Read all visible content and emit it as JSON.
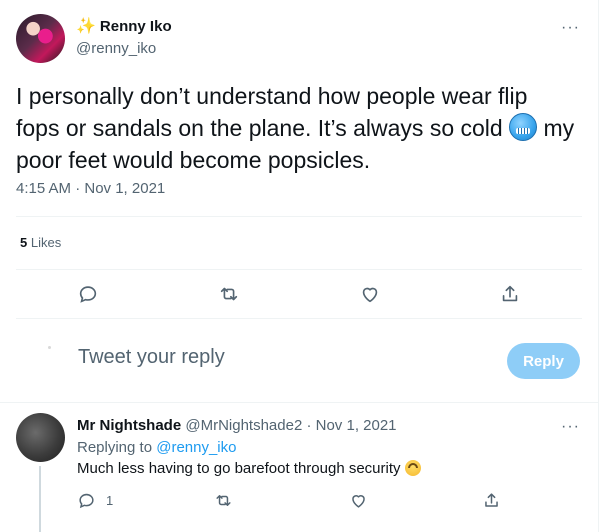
{
  "tweet": {
    "display_name": "Renny Iko",
    "handle": "@renny_iko",
    "text_part1": "I personally don’t understand how people wear flip fops or sandals on the plane. It’s always so cold ",
    "text_emoji": "cold-face",
    "text_part2": " my poor feet would become popsicles.",
    "timestamp": "4:15 AM · Nov 1, 2021",
    "likes_count": "5",
    "likes_label": "Likes"
  },
  "reply_box": {
    "placeholder": "Tweet your reply",
    "button_label": "Reply"
  },
  "reply": {
    "display_name": "Mr Nightshade",
    "meta": "@MrNightshade2 · Nov 1, 2021",
    "replying_prefix": "Replying to ",
    "replying_handle": "@renny_iko",
    "text": "Much less having to go barefoot through security ",
    "text_emoji": "upside-down-face",
    "reply_count": "1"
  },
  "icons": {
    "more": "more-icon",
    "reply": "reply-icon",
    "retweet": "retweet-icon",
    "like": "heart-icon",
    "share": "share-icon"
  },
  "colors": {
    "accent": "#1d9bf0",
    "reply_button": "#8ecdf7",
    "secondary_text": "#536471"
  }
}
